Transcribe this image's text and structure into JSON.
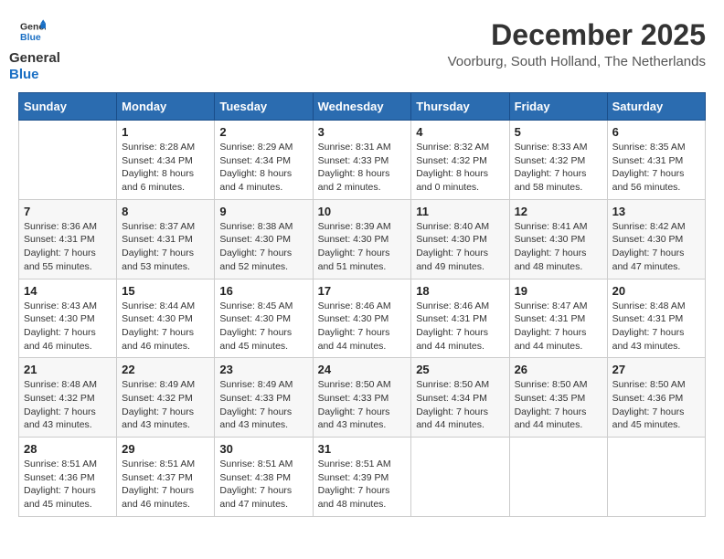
{
  "header": {
    "logo_text_general": "General",
    "logo_text_blue": "Blue",
    "month_year": "December 2025",
    "location": "Voorburg, South Holland, The Netherlands"
  },
  "weekdays": [
    "Sunday",
    "Monday",
    "Tuesday",
    "Wednesday",
    "Thursday",
    "Friday",
    "Saturday"
  ],
  "weeks": [
    [
      {
        "day": "",
        "info": ""
      },
      {
        "day": "1",
        "info": "Sunrise: 8:28 AM\nSunset: 4:34 PM\nDaylight: 8 hours\nand 6 minutes."
      },
      {
        "day": "2",
        "info": "Sunrise: 8:29 AM\nSunset: 4:34 PM\nDaylight: 8 hours\nand 4 minutes."
      },
      {
        "day": "3",
        "info": "Sunrise: 8:31 AM\nSunset: 4:33 PM\nDaylight: 8 hours\nand 2 minutes."
      },
      {
        "day": "4",
        "info": "Sunrise: 8:32 AM\nSunset: 4:32 PM\nDaylight: 8 hours\nand 0 minutes."
      },
      {
        "day": "5",
        "info": "Sunrise: 8:33 AM\nSunset: 4:32 PM\nDaylight: 7 hours\nand 58 minutes."
      },
      {
        "day": "6",
        "info": "Sunrise: 8:35 AM\nSunset: 4:31 PM\nDaylight: 7 hours\nand 56 minutes."
      }
    ],
    [
      {
        "day": "7",
        "info": "Sunrise: 8:36 AM\nSunset: 4:31 PM\nDaylight: 7 hours\nand 55 minutes."
      },
      {
        "day": "8",
        "info": "Sunrise: 8:37 AM\nSunset: 4:31 PM\nDaylight: 7 hours\nand 53 minutes."
      },
      {
        "day": "9",
        "info": "Sunrise: 8:38 AM\nSunset: 4:30 PM\nDaylight: 7 hours\nand 52 minutes."
      },
      {
        "day": "10",
        "info": "Sunrise: 8:39 AM\nSunset: 4:30 PM\nDaylight: 7 hours\nand 51 minutes."
      },
      {
        "day": "11",
        "info": "Sunrise: 8:40 AM\nSunset: 4:30 PM\nDaylight: 7 hours\nand 49 minutes."
      },
      {
        "day": "12",
        "info": "Sunrise: 8:41 AM\nSunset: 4:30 PM\nDaylight: 7 hours\nand 48 minutes."
      },
      {
        "day": "13",
        "info": "Sunrise: 8:42 AM\nSunset: 4:30 PM\nDaylight: 7 hours\nand 47 minutes."
      }
    ],
    [
      {
        "day": "14",
        "info": "Sunrise: 8:43 AM\nSunset: 4:30 PM\nDaylight: 7 hours\nand 46 minutes."
      },
      {
        "day": "15",
        "info": "Sunrise: 8:44 AM\nSunset: 4:30 PM\nDaylight: 7 hours\nand 46 minutes."
      },
      {
        "day": "16",
        "info": "Sunrise: 8:45 AM\nSunset: 4:30 PM\nDaylight: 7 hours\nand 45 minutes."
      },
      {
        "day": "17",
        "info": "Sunrise: 8:46 AM\nSunset: 4:30 PM\nDaylight: 7 hours\nand 44 minutes."
      },
      {
        "day": "18",
        "info": "Sunrise: 8:46 AM\nSunset: 4:31 PM\nDaylight: 7 hours\nand 44 minutes."
      },
      {
        "day": "19",
        "info": "Sunrise: 8:47 AM\nSunset: 4:31 PM\nDaylight: 7 hours\nand 44 minutes."
      },
      {
        "day": "20",
        "info": "Sunrise: 8:48 AM\nSunset: 4:31 PM\nDaylight: 7 hours\nand 43 minutes."
      }
    ],
    [
      {
        "day": "21",
        "info": "Sunrise: 8:48 AM\nSunset: 4:32 PM\nDaylight: 7 hours\nand 43 minutes."
      },
      {
        "day": "22",
        "info": "Sunrise: 8:49 AM\nSunset: 4:32 PM\nDaylight: 7 hours\nand 43 minutes."
      },
      {
        "day": "23",
        "info": "Sunrise: 8:49 AM\nSunset: 4:33 PM\nDaylight: 7 hours\nand 43 minutes."
      },
      {
        "day": "24",
        "info": "Sunrise: 8:50 AM\nSunset: 4:33 PM\nDaylight: 7 hours\nand 43 minutes."
      },
      {
        "day": "25",
        "info": "Sunrise: 8:50 AM\nSunset: 4:34 PM\nDaylight: 7 hours\nand 44 minutes."
      },
      {
        "day": "26",
        "info": "Sunrise: 8:50 AM\nSunset: 4:35 PM\nDaylight: 7 hours\nand 44 minutes."
      },
      {
        "day": "27",
        "info": "Sunrise: 8:50 AM\nSunset: 4:36 PM\nDaylight: 7 hours\nand 45 minutes."
      }
    ],
    [
      {
        "day": "28",
        "info": "Sunrise: 8:51 AM\nSunset: 4:36 PM\nDaylight: 7 hours\nand 45 minutes."
      },
      {
        "day": "29",
        "info": "Sunrise: 8:51 AM\nSunset: 4:37 PM\nDaylight: 7 hours\nand 46 minutes."
      },
      {
        "day": "30",
        "info": "Sunrise: 8:51 AM\nSunset: 4:38 PM\nDaylight: 7 hours\nand 47 minutes."
      },
      {
        "day": "31",
        "info": "Sunrise: 8:51 AM\nSunset: 4:39 PM\nDaylight: 7 hours\nand 48 minutes."
      },
      {
        "day": "",
        "info": ""
      },
      {
        "day": "",
        "info": ""
      },
      {
        "day": "",
        "info": ""
      }
    ]
  ]
}
